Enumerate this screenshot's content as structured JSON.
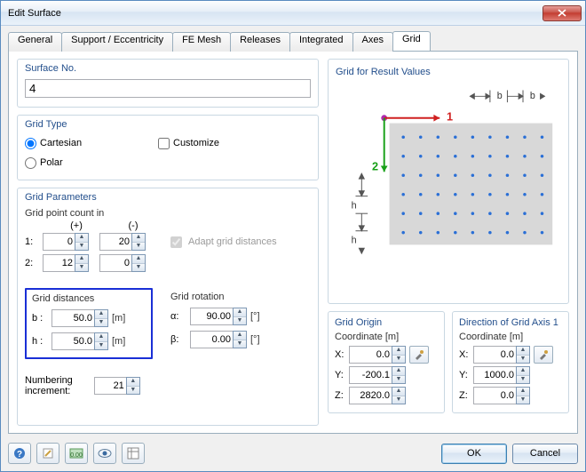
{
  "window": {
    "title": "Edit Surface"
  },
  "tabs": [
    "General",
    "Support / Eccentricity",
    "FE Mesh",
    "Releases",
    "Integrated",
    "Axes",
    "Grid"
  ],
  "activeTab": "Grid",
  "surfaceNo": {
    "label": "Surface No.",
    "value": "4"
  },
  "gridType": {
    "title": "Grid Type",
    "cartesian": "Cartesian",
    "polar": "Polar",
    "customize": "Customize",
    "selected": "cartesian",
    "customizeChecked": false
  },
  "gridParams": {
    "title": "Grid Parameters",
    "pointCountLabel": "Grid point count in",
    "plus": "(+)",
    "minus": "(-)",
    "row1": "1:",
    "row2": "2:",
    "v1p": "0",
    "v1m": "20",
    "v2p": "12",
    "v2m": "0",
    "adapt": "Adapt grid distances",
    "distTitle": "Grid distances",
    "bLabel": "b :",
    "bVal": "50.0",
    "bUnit": "[m]",
    "hLabel": "h :",
    "hVal": "50.0",
    "hUnit": "[m]",
    "rotTitle": "Grid rotation",
    "alphaLabel": "α:",
    "alphaVal": "90.00",
    "alphaUnit": "[°]",
    "betaLabel": "β:",
    "betaVal": "0.00",
    "betaUnit": "[°]",
    "numLabel": "Numbering",
    "incLabel": "increment:",
    "numVal": "21"
  },
  "preview": {
    "title": "Grid for Result Values",
    "axis1": "1",
    "axis2": "2",
    "bLabel": "b",
    "hLabel": "h"
  },
  "origin": {
    "title": "Grid Origin",
    "coord": "Coordinate  [m]",
    "x": "X:",
    "xv": "0.0",
    "y": "Y:",
    "yv": "-200.1",
    "z": "Z:",
    "zv": "2820.0"
  },
  "dir": {
    "title": "Direction of Grid Axis 1",
    "coord": "Coordinate  [m]",
    "x": "X:",
    "xv": "0.0",
    "y": "Y:",
    "yv": "1000.0",
    "z": "Z:",
    "zv": "0.0"
  },
  "footer": {
    "ok": "OK",
    "cancel": "Cancel"
  }
}
